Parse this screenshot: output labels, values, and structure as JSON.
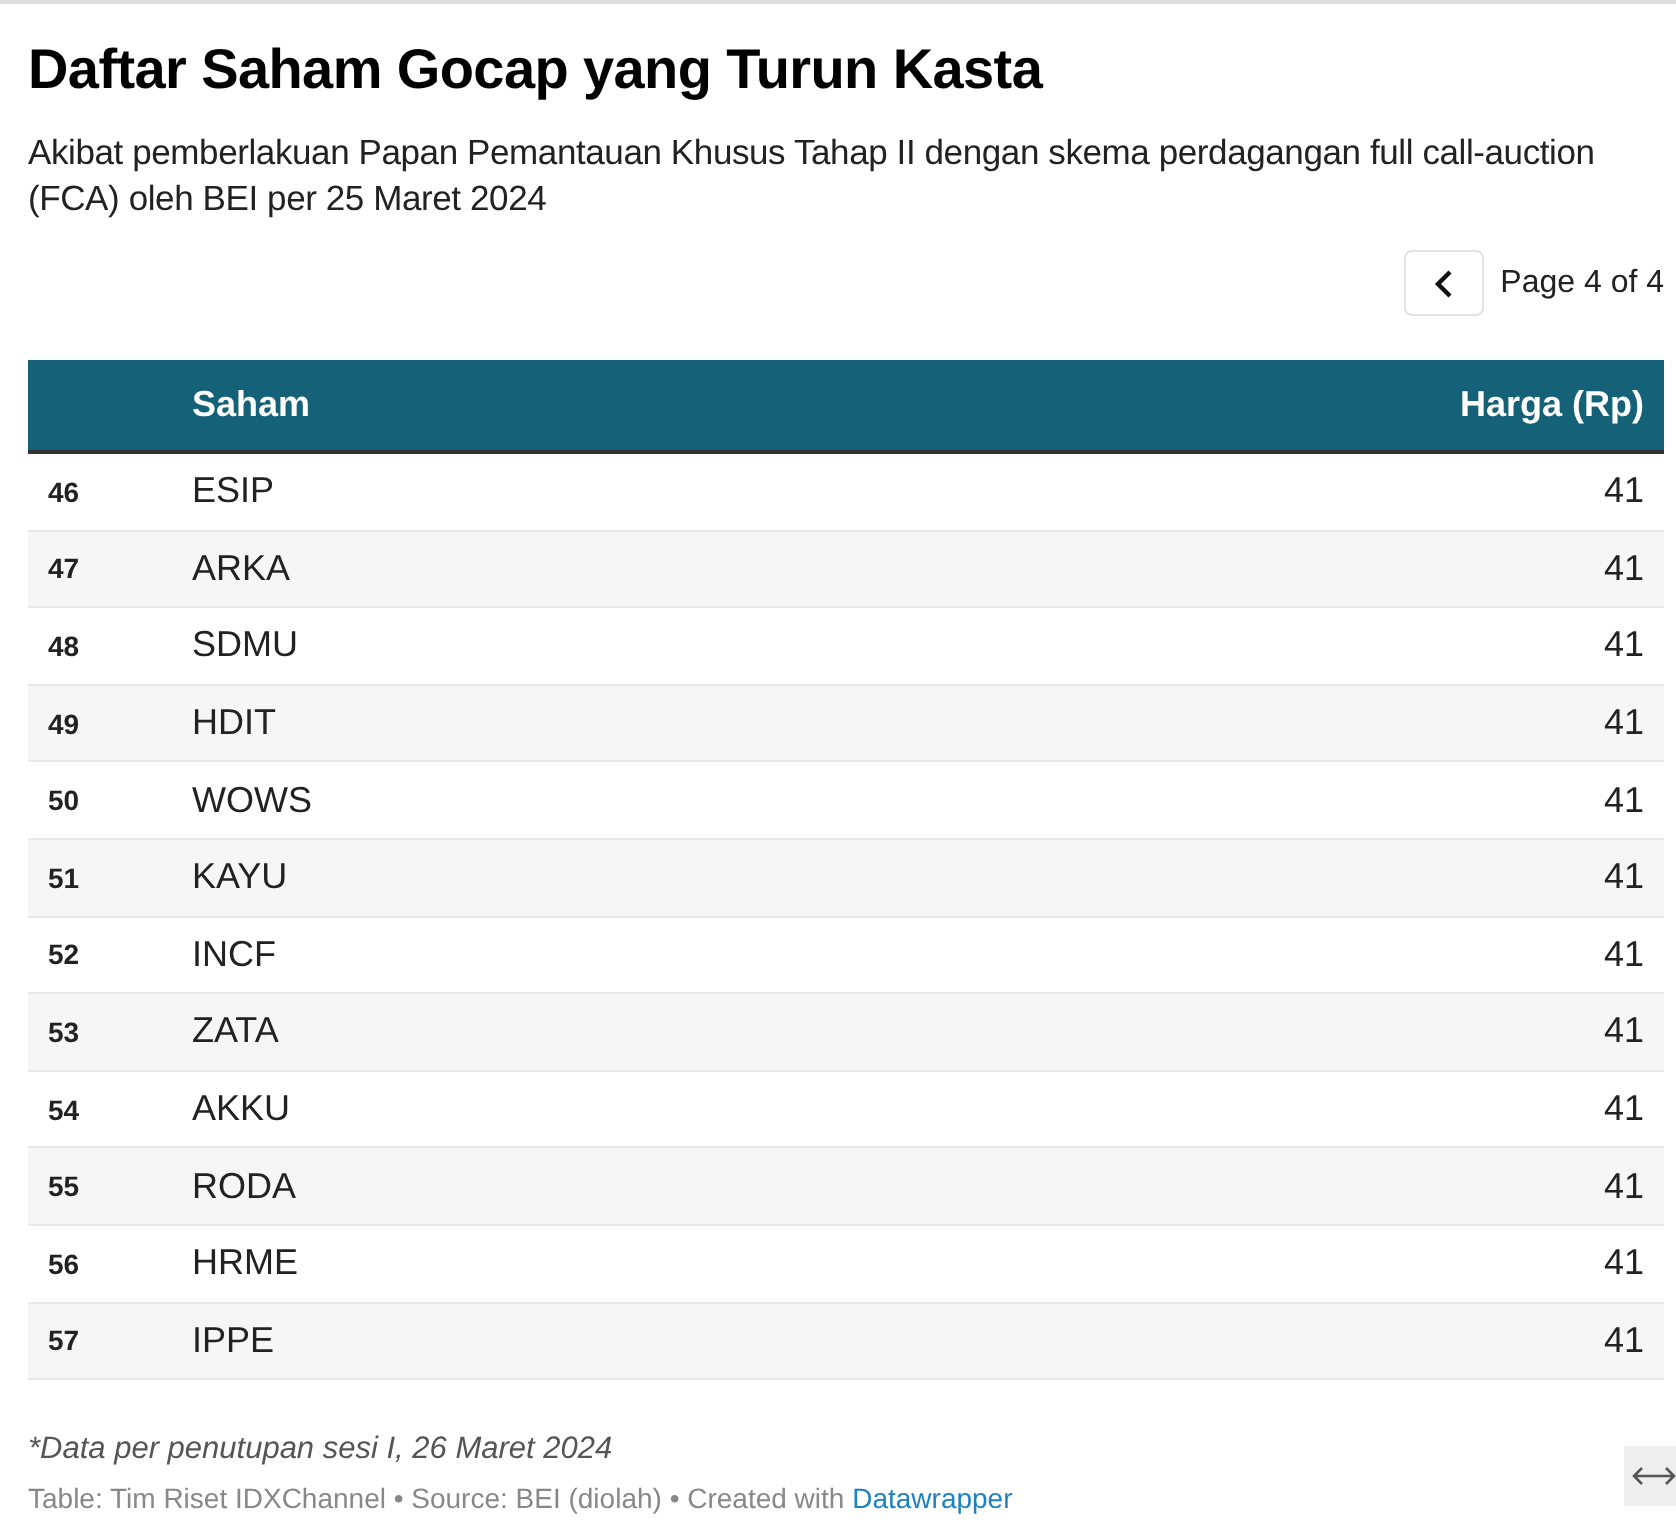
{
  "title": "Daftar Saham Gocap yang Turun Kasta",
  "subtitle": "Akibat pemberlakuan Papan Pemantauan Khusus Tahap II dengan skema perdagangan full call-auction (FCA) oleh BEI per 25 Maret 2024",
  "pagination": {
    "label": "Page 4 of 4"
  },
  "table": {
    "columns": [
      "Saham",
      "Harga (Rp)"
    ],
    "rows": [
      {
        "rank": "46",
        "saham": "ESIP",
        "harga": "41"
      },
      {
        "rank": "47",
        "saham": "ARKA",
        "harga": "41"
      },
      {
        "rank": "48",
        "saham": "SDMU",
        "harga": "41"
      },
      {
        "rank": "49",
        "saham": "HDIT",
        "harga": "41"
      },
      {
        "rank": "50",
        "saham": "WOWS",
        "harga": "41"
      },
      {
        "rank": "51",
        "saham": "KAYU",
        "harga": "41"
      },
      {
        "rank": "52",
        "saham": "INCF",
        "harga": "41"
      },
      {
        "rank": "53",
        "saham": "ZATA",
        "harga": "41"
      },
      {
        "rank": "54",
        "saham": "AKKU",
        "harga": "41"
      },
      {
        "rank": "55",
        "saham": "RODA",
        "harga": "41"
      },
      {
        "rank": "56",
        "saham": "HRME",
        "harga": "41"
      },
      {
        "rank": "57",
        "saham": "IPPE",
        "harga": "41"
      }
    ]
  },
  "note": "*Data per penutupan sesi I, 26 Maret 2024",
  "source": {
    "text": "Table: Tim Riset IDXChannel • Source: BEI (diolah) • Created with ",
    "link": "Datawrapper"
  }
}
